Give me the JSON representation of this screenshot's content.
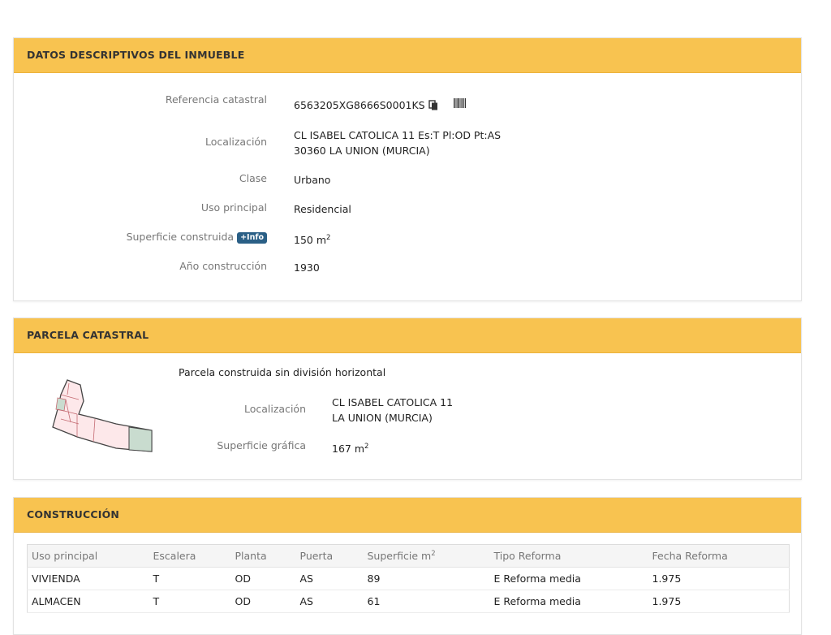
{
  "descriptive": {
    "title": "DATOS DESCRIPTIVOS DEL INMUEBLE",
    "ref_label": "Referencia catastral",
    "ref_value": "6563205XG8666S0001KS",
    "loc_label": "Localización",
    "loc_line1": "CL ISABEL CATOLICA 11 Es:T Pl:OD Pt:AS",
    "loc_line2": "30360 LA UNION (MURCIA)",
    "clase_label": "Clase",
    "clase_value": "Urbano",
    "uso_label": "Uso principal",
    "uso_value": "Residencial",
    "sup_label": "Superficie construida",
    "sup_badge": "+Info",
    "sup_value": "150 m",
    "sup_unit_exp": "2",
    "anio_label": "Año construcción",
    "anio_value": "1930"
  },
  "parcela": {
    "title": "PARCELA CATASTRAL",
    "subtitle": "Parcela construida sin división horizontal",
    "loc_label": "Localización",
    "loc_line1": "CL ISABEL CATOLICA 11",
    "loc_line2": "LA UNION (MURCIA)",
    "sup_label": "Superficie gráfica",
    "sup_value": "167 m",
    "sup_unit_exp": "2"
  },
  "construccion": {
    "title": "CONSTRUCCIÓN",
    "headers": [
      "Uso principal",
      "Escalera",
      "Planta",
      "Puerta",
      "Superficie m",
      "Tipo Reforma",
      "Fecha Reforma"
    ],
    "sup_header_exp": "2",
    "rows": [
      [
        "VIVIENDA",
        "T",
        "OD",
        "AS",
        "89",
        "E Reforma media",
        "1.975"
      ],
      [
        "ALMACEN",
        "T",
        "OD",
        "AS",
        "61",
        "E Reforma media",
        "1.975"
      ]
    ]
  },
  "icons": {
    "copy": "copy-icon",
    "barcode": "barcode-icon"
  },
  "colors": {
    "header_bg": "#f8c350",
    "badge_bg": "#2a5f86",
    "parcel_fill": "#fde8ea",
    "parcel_stroke": "#c46a72",
    "parcel_highlight": "#c9dccf"
  }
}
